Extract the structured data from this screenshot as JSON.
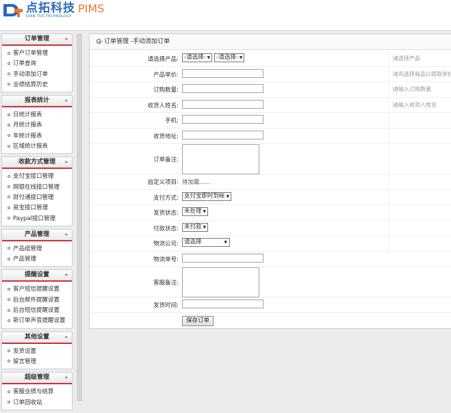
{
  "brand": {
    "name_cn": "点拓科技",
    "name_en": "DIAN TUO TECHNOLOGY",
    "product": "PIMS",
    "primary_color": "#2a6ab8",
    "accent_color": "#e8762b"
  },
  "sidebar": {
    "sections": [
      {
        "title": "订单管理",
        "items": [
          "客户订单管理",
          "订单查询",
          "手动添加订单",
          "业绩结算历史"
        ]
      },
      {
        "title": "报表统计",
        "items": [
          "日统计报表",
          "月统计报表",
          "年统计报表",
          "区域统计报表"
        ]
      },
      {
        "title": "收款方式管理",
        "items": [
          "支付宝接口管理",
          "网银在线接口管理",
          "财付通接口管理",
          "易宝接口管理",
          "Paypal接口管理"
        ]
      },
      {
        "title": "产品管理",
        "items": [
          "产品组管理",
          "产品管理"
        ]
      },
      {
        "title": "提醒设置",
        "items": [
          "客户短信提醒设置",
          "后台邮件提醒设置",
          "后台短信提醒设置",
          "新订单声音提醒设置"
        ]
      },
      {
        "title": "其他设置",
        "items": [
          "发货设置",
          "留言管理"
        ]
      },
      {
        "title": "超级管理",
        "items": [
          "客服业绩与结算",
          "订单回收站"
        ]
      }
    ],
    "chevron": "»"
  },
  "main": {
    "title": "订单管理 -手动添加订单",
    "form": {
      "product": {
        "label": "请选择产品:",
        "select1": "-请选择-",
        "select2": "-请选择-",
        "hint": "请选择产品"
      },
      "unit_price": {
        "label": "产品单价:",
        "value": "",
        "hint": "请先选择商品以提取单价"
      },
      "quantity": {
        "label": "订购数量:",
        "value": "",
        "hint": "请输入订购数量"
      },
      "receiver_name": {
        "label": "收货人姓名:",
        "value": "",
        "hint": "请输入收货人姓名"
      },
      "mobile": {
        "label": "手机:",
        "value": ""
      },
      "address": {
        "label": "收货地址:",
        "value": ""
      },
      "order_note": {
        "label": "订单备注:",
        "value": ""
      },
      "custom_fields": {
        "label": "自定义项目:",
        "value": "待加载......"
      },
      "payment_method": {
        "label": "支付方式:",
        "value": "支付宝即时到帐"
      },
      "shipping_status": {
        "label": "发货状态:",
        "value": "未处理"
      },
      "payment_status": {
        "label": "付款状态:",
        "value": "未付款"
      },
      "logistics_company": {
        "label": "物流公司:",
        "value": "请选择"
      },
      "tracking_number": {
        "label": "物流单号:",
        "value": ""
      },
      "service_note": {
        "label": "客服备注:",
        "value": ""
      },
      "ship_time": {
        "label": "发货时间:",
        "value": ""
      },
      "submit_label": "保存订单"
    }
  },
  "colors": {
    "section_underline": "#c8323a",
    "hint_text": "#999999"
  }
}
